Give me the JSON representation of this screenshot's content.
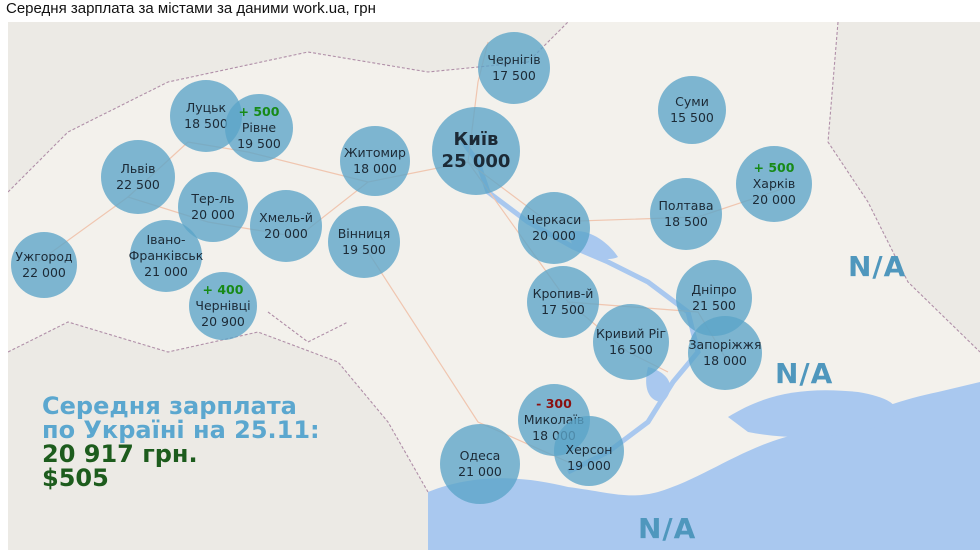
{
  "title": "Середня зарплата за містами за даними work.ua, грн",
  "cities": [
    {
      "key": "uzhhorod",
      "name": "Ужгород",
      "value": "22 000"
    },
    {
      "key": "lviv",
      "name": "Львів",
      "value": "22 500"
    },
    {
      "key": "lutsk",
      "name": "Луцьк",
      "value": "18 500"
    },
    {
      "key": "rivne",
      "name": "Рівне",
      "value": "19 500",
      "delta": "+ 500"
    },
    {
      "key": "ternopil",
      "name": "Тер-ль",
      "value": "20 000"
    },
    {
      "key": "ivano",
      "name": "Івано-\nФранківськ",
      "value": "21 000"
    },
    {
      "key": "chernivtsi",
      "name": "Чернівці",
      "value": "20 900",
      "delta": "+ 400"
    },
    {
      "key": "khmelnytskyi",
      "name": "Хмель-й",
      "value": "20 000"
    },
    {
      "key": "zhytomyr",
      "name": "Житомир",
      "value": "18 000"
    },
    {
      "key": "vinnytsia",
      "name": "Вінниця",
      "value": "19 500"
    },
    {
      "key": "kyiv",
      "name": "Київ",
      "value": "25 000"
    },
    {
      "key": "chernihiv",
      "name": "Чернігів",
      "value": "17 500"
    },
    {
      "key": "sumy",
      "name": "Суми",
      "value": "15 500"
    },
    {
      "key": "kharkiv",
      "name": "Харків",
      "value": "20 000",
      "delta": "+ 500"
    },
    {
      "key": "poltava",
      "name": "Полтава",
      "value": "18 500"
    },
    {
      "key": "cherkasy",
      "name": "Черкаси",
      "value": "20 000"
    },
    {
      "key": "kropyvnytskyi",
      "name": "Кропив-й",
      "value": "17 500"
    },
    {
      "key": "dnipro",
      "name": "Дніпро",
      "value": "21 500"
    },
    {
      "key": "kryvyi",
      "name": "Кривий Ріг",
      "value": "16 500"
    },
    {
      "key": "zaporizhzhia",
      "name": "Запоріжжя",
      "value": "18 000"
    },
    {
      "key": "mykolaiv",
      "name": "Миколаїв",
      "value": "18 000",
      "delta": "- 300"
    },
    {
      "key": "odesa",
      "name": "Одеса",
      "value": "21 000"
    },
    {
      "key": "kherson",
      "name": "Херсон",
      "value": "19 000"
    }
  ],
  "na_labels": [
    "N/A",
    "N/A",
    "N/A"
  ],
  "summary": {
    "line1": "Середня зарплата",
    "line2": "по Україні на 25.11:",
    "line3": "20 917 грн.",
    "line4": "$505"
  },
  "colors": {
    "bubble": "#5ba4c8",
    "positive_delta": "#178a17",
    "negative_delta": "#8a1010",
    "summary_blue": "#5ba7cf",
    "summary_green": "#1d5c1d",
    "water": "#a9c8ef",
    "land": "#f4f2ee"
  }
}
